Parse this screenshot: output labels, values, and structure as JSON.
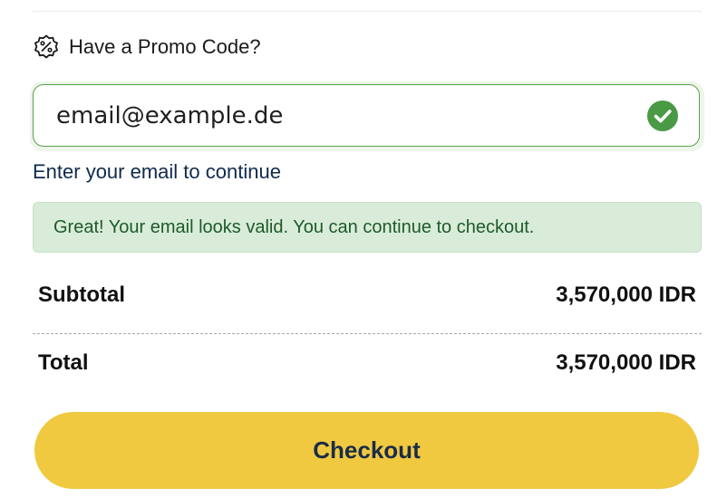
{
  "promo": {
    "label": "Have a Promo Code?",
    "icon": "percent-badge-icon"
  },
  "email": {
    "value": "email@example.de",
    "status_icon": "check-circle-icon",
    "status_color": "#4a9a45",
    "border_color": "#58a14a"
  },
  "helper_text": "Enter your email to continue",
  "success_message": "Great! Your email looks valid. You can continue to checkout.",
  "summary": {
    "subtotal_label": "Subtotal",
    "subtotal_value": "3,570,000 IDR",
    "total_label": "Total",
    "total_value": "3,570,000 IDR"
  },
  "checkout": {
    "label": "Checkout",
    "color": "#f0c940"
  }
}
